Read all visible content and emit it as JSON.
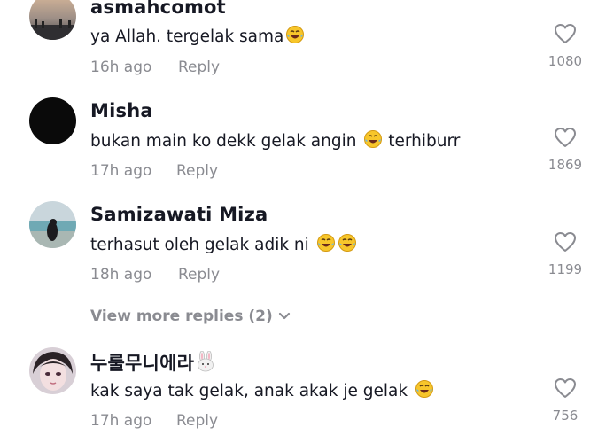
{
  "comments": [
    {
      "username": "asmahcomot",
      "text": "ya Allah. tergelak sama",
      "emojis": [
        "laughing-tears"
      ],
      "time": "16h ago",
      "reply_label": "Reply",
      "likes": "1080"
    },
    {
      "username": "Misha",
      "text": "bukan main ko dekk gelak angin",
      "emoji_mid": "laughing-tears",
      "text_after": " terhiburr",
      "time": "17h ago",
      "reply_label": "Reply",
      "likes": "1869"
    },
    {
      "username": "Samizawati Miza",
      "text": "terhasut oleh gelak adik ni ",
      "emojis": [
        "laughing-tears",
        "laughing-tears"
      ],
      "time": "18h ago",
      "reply_label": "Reply",
      "likes": "1199"
    },
    {
      "username": "누룰무니에라",
      "username_emoji": "rabbit-face",
      "text": "kak saya tak gelak, anak akak je gelak ",
      "emojis": [
        "laughing-tears"
      ],
      "time": "17h ago",
      "reply_label": "Reply",
      "likes": "756"
    }
  ],
  "view_more_replies": "View more replies (2)",
  "colors": {
    "primary_text": "#161823",
    "secondary_text": "#8a8b91",
    "background": "#ffffff"
  }
}
